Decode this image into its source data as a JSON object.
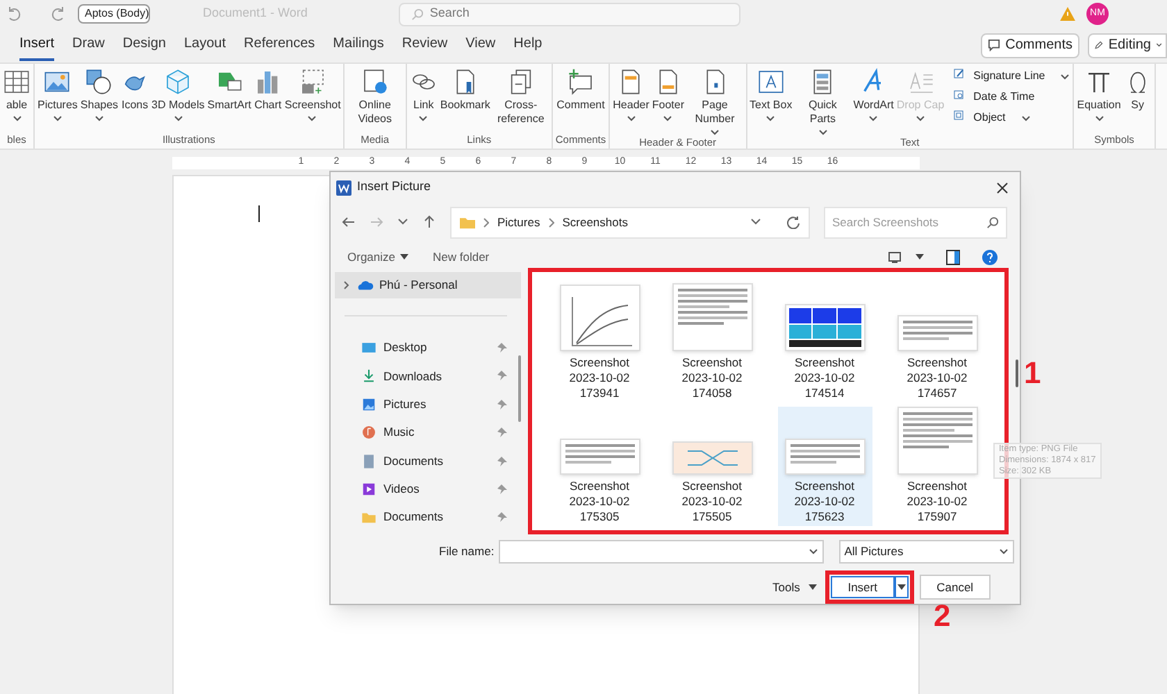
{
  "titlebar": {
    "font_box": "Aptos (Body)",
    "document_title": "Document1 - Word",
    "search_placeholder": "Search",
    "avatar": "NM"
  },
  "tabs": [
    {
      "label": "Insert",
      "selected": true
    },
    {
      "label": "Draw",
      "selected": false
    },
    {
      "label": "Design",
      "selected": false
    },
    {
      "label": "Layout",
      "selected": false
    },
    {
      "label": "References",
      "selected": false
    },
    {
      "label": "Mailings",
      "selected": false
    },
    {
      "label": "Review",
      "selected": false
    },
    {
      "label": "View",
      "selected": false
    },
    {
      "label": "Help",
      "selected": false
    }
  ],
  "header_buttons": [
    {
      "label": "Comments",
      "kind": "comments"
    },
    {
      "label": "Editing",
      "kind": "editing"
    }
  ],
  "ribbon_groups": [
    {
      "label": "bles",
      "items": [
        {
          "label": "able",
          "kind": "table",
          "caret": true
        }
      ]
    },
    {
      "label": "Illustrations",
      "items": [
        {
          "label": "Pictures",
          "kind": "pictures",
          "caret": true
        },
        {
          "label": "Shapes",
          "kind": "shapes",
          "caret": true
        },
        {
          "label": "Icons",
          "kind": "icons",
          "caret": false
        },
        {
          "label": "3D Models",
          "kind": "cube",
          "caret": true
        },
        {
          "label": "SmartArt",
          "kind": "smartart",
          "caret": false
        },
        {
          "label": "Chart",
          "kind": "chart",
          "caret": false
        },
        {
          "label": "Screenshot",
          "kind": "screenshot",
          "caret": true
        }
      ]
    },
    {
      "label": "Media",
      "items": [
        {
          "label": "Online Videos",
          "kind": "video",
          "caret": false
        }
      ]
    },
    {
      "label": "Links",
      "items": [
        {
          "label": "Link",
          "kind": "link",
          "caret": true
        },
        {
          "label": "Bookmark",
          "kind": "bookmark",
          "caret": false
        },
        {
          "label": "Cross-reference",
          "kind": "crossref",
          "caret": false
        }
      ]
    },
    {
      "label": "Comments",
      "items": [
        {
          "label": "Comment",
          "kind": "comment",
          "caret": false
        }
      ]
    },
    {
      "label": "Header & Footer",
      "items": [
        {
          "label": "Header",
          "kind": "header",
          "caret": true
        },
        {
          "label": "Footer",
          "kind": "footer",
          "caret": true
        },
        {
          "label": "Page Number",
          "kind": "pagenumber",
          "caret": true
        }
      ]
    },
    {
      "label": "Text",
      "items": [
        {
          "label": "Text Box",
          "kind": "textbox",
          "caret": true,
          "disabled": false
        },
        {
          "label": "Quick Parts",
          "kind": "quickparts",
          "caret": true,
          "disabled": false
        },
        {
          "label": "WordArt",
          "kind": "wordart",
          "caret": true,
          "disabled": false
        },
        {
          "label": "Drop Cap",
          "kind": "dropcap",
          "caret": true,
          "disabled": true
        }
      ],
      "small_items": [
        {
          "label": "Signature Line",
          "kind": "signature",
          "caret": true
        },
        {
          "label": "Date & Time",
          "kind": "datetime",
          "caret": false
        },
        {
          "label": "Object",
          "kind": "object",
          "caret": true
        }
      ]
    },
    {
      "label": "Symbols",
      "items": [
        {
          "label": "Equation",
          "kind": "equation",
          "caret": true
        },
        {
          "label": "Sy",
          "kind": "symbol",
          "caret": false
        }
      ]
    }
  ],
  "ruler": {
    "numbers": [
      "1",
      "2",
      "3",
      "4",
      "5",
      "6",
      "7",
      "8",
      "9",
      "10",
      "11",
      "12",
      "13",
      "14",
      "15",
      "16"
    ]
  },
  "dialog": {
    "title": "Insert Picture",
    "breadcrumb": [
      "Pictures",
      "Screenshots"
    ],
    "search_placeholder": "Search Screenshots",
    "organize": "Organize",
    "new_folder": "New folder",
    "nav_items": [
      {
        "label": "Phú - Personal",
        "kind": "cloud",
        "selected": true
      },
      {
        "label": "Desktop",
        "kind": "desktop",
        "selected": false
      },
      {
        "label": "Downloads",
        "kind": "download",
        "selected": false
      },
      {
        "label": "Pictures",
        "kind": "pictures",
        "selected": false
      },
      {
        "label": "Music",
        "kind": "music",
        "selected": false
      },
      {
        "label": "Documents",
        "kind": "documents",
        "selected": false
      },
      {
        "label": "Videos",
        "kind": "videos",
        "selected": false
      },
      {
        "label": "Documents",
        "kind": "folder",
        "selected": false
      }
    ],
    "files": [
      {
        "name": "Screenshot 2023-10-02 173941",
        "kind": "plot",
        "selected": false
      },
      {
        "name": "Screenshot 2023-10-02 174058",
        "kind": "page",
        "selected": false
      },
      {
        "name": "Screenshot 2023-10-02 174514",
        "kind": "heatmap",
        "selected": false
      },
      {
        "name": "Screenshot 2023-10-02 174657",
        "kind": "wide",
        "selected": false
      },
      {
        "name": "Screenshot 2023-10-02 175305",
        "kind": "wide",
        "selected": false
      },
      {
        "name": "Screenshot 2023-10-02 175505",
        "kind": "diagram",
        "selected": false
      },
      {
        "name": "Screenshot 2023-10-02 175623",
        "kind": "wide",
        "selected": true
      },
      {
        "name": "Screenshot 2023-10-02 175907",
        "kind": "page",
        "selected": false
      }
    ],
    "tooltip": [
      "Item type: PNG File",
      "Dimensions: 1874 x 817",
      "Size: 302 KB"
    ],
    "file_name_label": "File name:",
    "file_type": "All Pictures",
    "tools": "Tools",
    "insert": "Insert",
    "cancel": "Cancel"
  },
  "annotations": [
    "1",
    "2"
  ]
}
